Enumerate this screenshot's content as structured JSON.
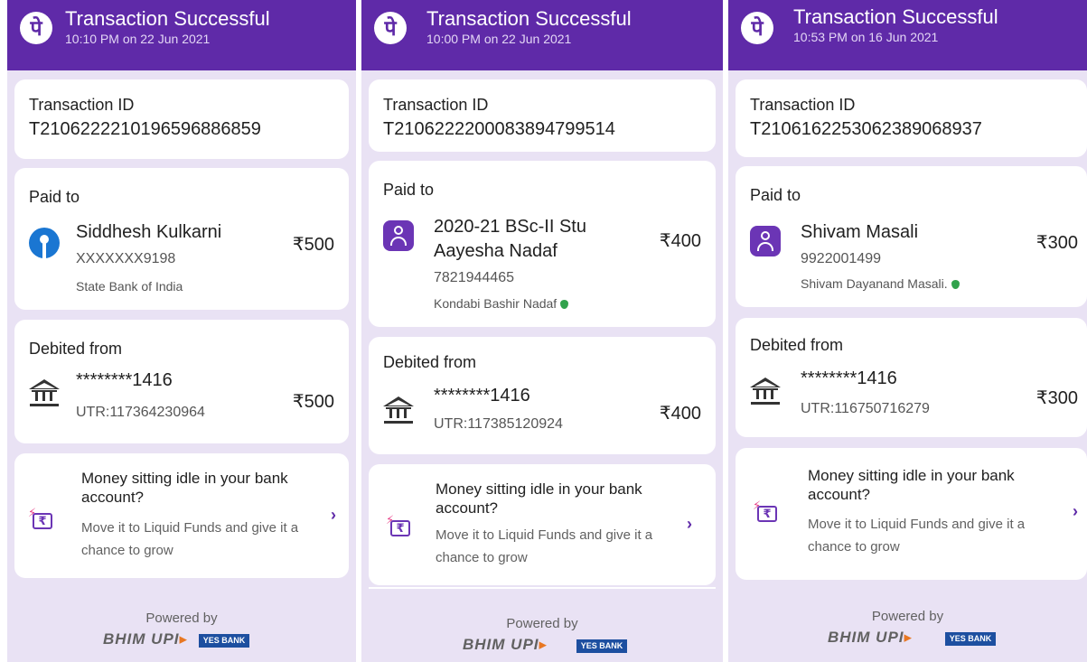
{
  "receipts": [
    {
      "header": {
        "title": "Transaction Successful",
        "datetime": "10:10 PM on 22 Jun 2021",
        "logo": "पे"
      },
      "transaction": {
        "label": "Transaction ID",
        "id": "T2106222210196596886859"
      },
      "paid_to": {
        "label": "Paid to",
        "name": "Siddhesh Kulkarni",
        "account": "XXXXXXX9198",
        "bank": "State Bank of India",
        "amount": "₹500",
        "icon": "sbi-icon"
      },
      "debited": {
        "label": "Debited from",
        "account": "********1416",
        "utr": "UTR:117364230964",
        "amount": "₹500",
        "icon": "bank-icon"
      },
      "promo": {
        "title": "Money sitting idle in your bank account?",
        "body": "Move it to Liquid Funds and give it a chance to grow",
        "chevron": "›",
        "icon_symbol": "₹"
      },
      "footer": {
        "powered": "Powered by",
        "upi_brand": "BHIM UPI",
        "bank_brand": "YES BANK"
      }
    },
    {
      "header": {
        "title": "Transaction Successful",
        "datetime": "10:00 PM on 22 Jun 2021",
        "logo": "पे"
      },
      "transaction": {
        "label": "Transaction ID",
        "id": "T2106222200083894799514"
      },
      "paid_to": {
        "label": "Paid to",
        "name_line1": "2020-21 BSc-II Stu",
        "name_line2": "Aayesha Nadaf",
        "phone": "7821944465",
        "verified_name": "Kondabi Bashir Nadaf",
        "amount": "₹400",
        "icon": "user-icon"
      },
      "debited": {
        "label": "Debited from",
        "account": "********1416",
        "utr": "UTR:117385120924",
        "amount": "₹400",
        "icon": "bank-icon"
      },
      "promo": {
        "title": "Money sitting idle in your bank account?",
        "body": "Move it to Liquid Funds and give it a chance to grow",
        "chevron": "›",
        "icon_symbol": "₹"
      },
      "footer": {
        "powered": "Powered by",
        "upi_brand": "BHIM UPI",
        "bank_brand": "YES BANK"
      }
    },
    {
      "header": {
        "title": "Transaction Successful",
        "datetime": "10:53 PM on 16 Jun 2021",
        "logo": "पे"
      },
      "transaction": {
        "label": "Transaction ID",
        "id": "T2106162253062389068937"
      },
      "paid_to": {
        "label": "Paid to",
        "name": "Shivam Masali",
        "phone": "9922001499",
        "verified_name": "Shivam Dayanand Masali.",
        "amount": "₹300",
        "icon": "user-icon"
      },
      "debited": {
        "label": "Debited from",
        "account": "********1416",
        "utr": "UTR:116750716279",
        "amount": "₹300",
        "icon": "bank-icon"
      },
      "promo": {
        "title": "Money sitting idle in your bank account?",
        "body": "Move it to Liquid Funds and give it a chance to grow",
        "chevron": "›",
        "icon_symbol": "₹"
      },
      "footer": {
        "powered": "Powered by",
        "upi_brand": "BHIM UPI",
        "bank_brand": "YES BANK"
      }
    }
  ],
  "colors": {
    "brand_purple": "#5f2aa8",
    "panel_bg": "#e9e2f4",
    "verified_green": "#31a24c",
    "sbi_blue": "#1a76d2"
  }
}
